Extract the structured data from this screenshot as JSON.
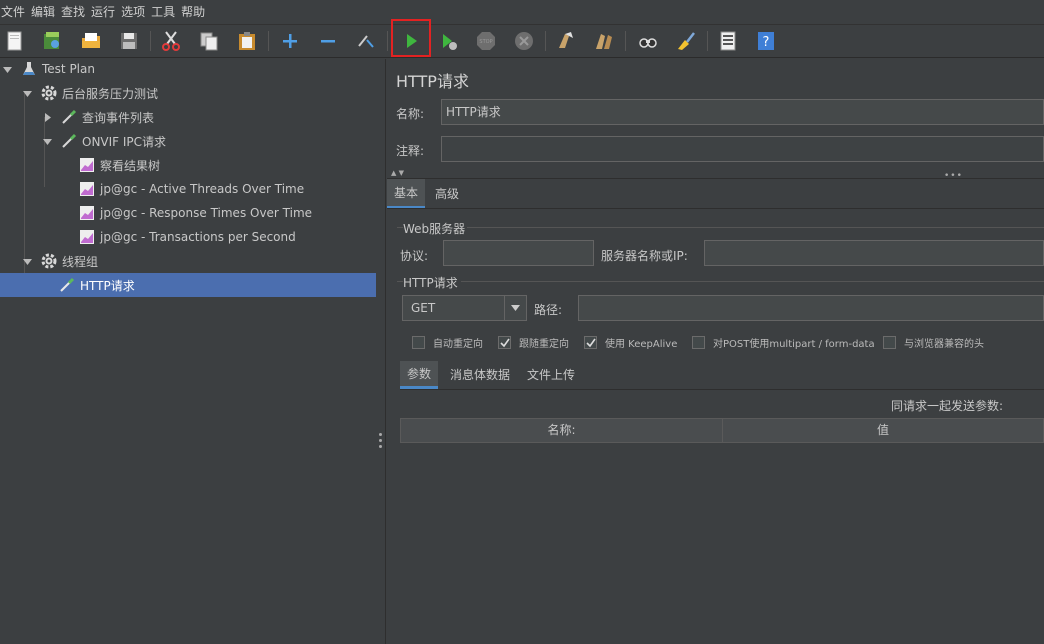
{
  "menu": [
    "文件",
    "编辑",
    "查找",
    "运行",
    "选项",
    "工具",
    "帮助"
  ],
  "toolbar": {
    "buttons": [
      "new-icon",
      "templates-icon",
      "open-icon",
      "save-icon",
      "cut-icon",
      "copy-icon",
      "paste-icon",
      "expand-icon",
      "collapse-icon",
      "toggle-icon",
      "start-icon",
      "start-no-pause-icon",
      "stop-icon",
      "shutdown-icon",
      "clear-icon",
      "clear-all-icon",
      "search-icon",
      "reset-search-icon",
      "function-helper-icon",
      "help-icon"
    ]
  },
  "tree": {
    "test_plan": "Test Plan",
    "backend_group": "后台服务压力测试",
    "query_events": "查询事件列表",
    "onvif": "ONVIF IPC请求",
    "view_results": "察看结果树",
    "active_threads": "jp@gc - Active Threads Over Time",
    "response_times": "jp@gc - Response Times Over Time",
    "transactions": "jp@gc - Transactions per Second",
    "thread_group": "线程组",
    "http_request": "HTTP请求"
  },
  "panel": {
    "title": "HTTP请求",
    "name_label": "名称:",
    "name_value": "HTTP请求",
    "comment_label": "注释:",
    "comment_value": "",
    "tabs": [
      "基本",
      "高级"
    ],
    "web_server_title": "Web服务器",
    "protocol_label": "协议:",
    "protocol_value": "",
    "server_label": "服务器名称或IP:",
    "server_value": "",
    "http_request_title": "HTTP请求",
    "method": "GET",
    "path_label": "路径:",
    "path_value": "",
    "checkboxes": [
      {
        "label": "自动重定向",
        "checked": false
      },
      {
        "label": "跟随重定向",
        "checked": true
      },
      {
        "label": "使用 KeepAlive",
        "checked": true
      },
      {
        "label": "对POST使用multipart / form-data",
        "checked": false
      },
      {
        "label": "与浏览器兼容的头",
        "checked": false
      }
    ],
    "sub_tabs": [
      "参数",
      "消息体数据",
      "文件上传"
    ],
    "send_params_label": "同请求一起发送参数:",
    "table_headers": [
      "名称:",
      "值"
    ]
  },
  "colors": {
    "background": "#3c3f41",
    "selection": "#4b6eaf",
    "highlight_box": "#e32222"
  }
}
